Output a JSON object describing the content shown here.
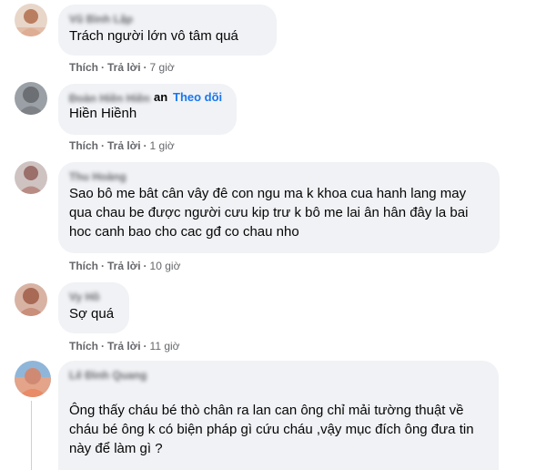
{
  "comments": [
    {
      "author": "Vũ Bình Lập",
      "text": "Trách người lớn vô tâm quá",
      "like_label": "Thích",
      "reply_label": "Trả lời",
      "time": "7 giờ",
      "avatar_color": "#d9a487"
    },
    {
      "author": "Đoàn Hiền Hiền",
      "name_suffix": "an",
      "follow_label": "Theo dõi",
      "text": "Hiền Hiềnh",
      "like_label": "Thích",
      "reply_label": "Trả lời",
      "time": "1 giờ",
      "avatar_color": "#8a8f96"
    },
    {
      "author": "Thu Hoàng",
      "text": "Sao bô me bât cân vây đê con ngu ma k khoa cua hanh lang may qua chau be được người cưu kip trư k bô me lai ân hân đây la bai hoc canh bao cho cac gđ co chau nho",
      "like_label": "Thích",
      "reply_label": "Trả lời",
      "time": "10 giờ",
      "avatar_color": "#b88c84"
    },
    {
      "author": "Vy Hồ",
      "text": "Sợ quá",
      "like_label": "Thích",
      "reply_label": "Trả lời",
      "time": "11 giờ",
      "avatar_color": "#c98f7a"
    },
    {
      "author": "Lê Đình Quang",
      "text": "Ông thấy cháu bé thò chân ra lan can ông chỉ mải tường thuật về cháu bé ông k có biện pháp gì cứu cháu ,vậy mục đích ông đưa tin này để làm gì ?",
      "avatar_color": "#d08a74"
    }
  ]
}
